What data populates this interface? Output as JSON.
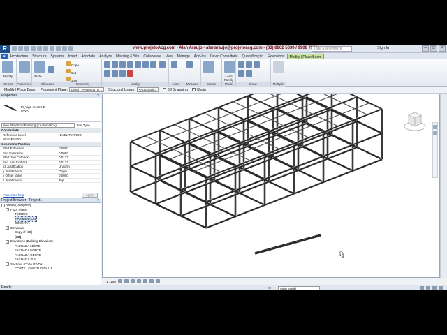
{
  "title_bar": {
    "app_logo": "R",
    "title": "www.projetoAcg.com - Alan Araujo - alanaraujo@projetoacg.com - (83) 8862 5630 / 9908 7970",
    "search_placeholder": "Type a keyword or phrase",
    "sign_in": "Sign In"
  },
  "tabs": [
    {
      "label": "Architecture"
    },
    {
      "label": "Structure"
    },
    {
      "label": "Systems"
    },
    {
      "label": "Insert"
    },
    {
      "label": "Annotate"
    },
    {
      "label": "Analyze"
    },
    {
      "label": "Massing & Site"
    },
    {
      "label": "Collaborate"
    },
    {
      "label": "View"
    },
    {
      "label": "Manage"
    },
    {
      "label": "Add-Ins"
    },
    {
      "label": "David Consultoria"
    },
    {
      "label": "Quantificação"
    },
    {
      "label": "Extensions"
    },
    {
      "label": "Modify | Place Beam"
    }
  ],
  "ribbon": {
    "modify": "Modify",
    "paste": "Paste",
    "cope": "Cope",
    "cut": "Cut",
    "join": "Join",
    "load_family": "Load Family",
    "groups": [
      "Select",
      "Properties",
      "Clipboard",
      "Geometry",
      "Modify",
      "View",
      "Measure",
      "Create",
      "Mode",
      "Draw",
      "Multiple"
    ]
  },
  "options_bar": {
    "modify_label": "Modify | Place Beam",
    "placement_plane_label": "Placement Plane:",
    "placement_plane_value": "Level : PAVIMENTO 1",
    "structural_usage_label": "Structural Usage:",
    "structural_usage_value": "<Automatic>",
    "snapping": "3D Snapping",
    "chain": "Chain"
  },
  "properties": {
    "header": "Properties",
    "type_family": "M_Viga-mestra-E",
    "type_name": "50X0",
    "instance_selector": "New Structural Framing (<Automatic>)",
    "edit_type": "Edit Type",
    "categories": [
      {
        "label": "Constraints",
        "rows": [
          {
            "k": "Reference Level",
            "v": "NIVEL TERREO"
          },
          {
            "k": "PAVIMENTO",
            "v": ""
          }
        ]
      },
      {
        "label": "Geometric Position",
        "rows": [
          {
            "k": "Start Extension",
            "v": "0,0000"
          },
          {
            "k": "End Extension",
            "v": "0,0000"
          },
          {
            "k": "Start Join Cutback",
            "v": "0,0127"
          },
          {
            "k": "End Join Cutback",
            "v": "0,0127"
          },
          {
            "k": "yz Justification",
            "v": "Uniform"
          },
          {
            "k": "y Justification",
            "v": "Origin"
          },
          {
            "k": "y Offset Value",
            "v": "0,0000"
          },
          {
            "k": "z Justification",
            "v": "Top"
          }
        ]
      }
    ],
    "help_link": "Properties help",
    "apply": "Apply"
  },
  "project_browser": {
    "header": "Project Browser - Project1",
    "nodes": [
      {
        "label": "Views (Discipline)",
        "toggle": "-",
        "indent": 0
      },
      {
        "label": "Floor Plans",
        "toggle": "-",
        "indent": 1
      },
      {
        "label": "TERREO",
        "toggle": "",
        "indent": 2
      },
      {
        "label": "PAVIMENTO 1",
        "toggle": "",
        "indent": 2
      },
      {
        "label": "COBERTA",
        "toggle": "",
        "indent": 2
      },
      {
        "label": "3D Views",
        "toggle": "-",
        "indent": 1
      },
      {
        "label": "Copy of {3D}",
        "toggle": "",
        "indent": 2
      },
      {
        "label": "{3D}",
        "toggle": "",
        "indent": 2
      },
      {
        "label": "Elevations (Building Elevation)",
        "toggle": "-",
        "indent": 1
      },
      {
        "label": "FACHADA LESTE",
        "toggle": "",
        "indent": 2
      },
      {
        "label": "FACHADA NORTE",
        "toggle": "",
        "indent": 2
      },
      {
        "label": "FACHADA OESTE",
        "toggle": "",
        "indent": 2
      },
      {
        "label": "FACHADA SUL",
        "toggle": "",
        "indent": 2
      },
      {
        "label": "Sections (Corte PX/DX)",
        "toggle": "-",
        "indent": 1
      },
      {
        "label": "CORTE LONGITUDINAL 1",
        "toggle": "",
        "indent": 2
      }
    ]
  },
  "view": {
    "scale": "1 : 100",
    "viewcube_face": "FRONT"
  },
  "status_bar": {
    "status": "Ready",
    "zero": ":0",
    "model": "Main Model"
  }
}
